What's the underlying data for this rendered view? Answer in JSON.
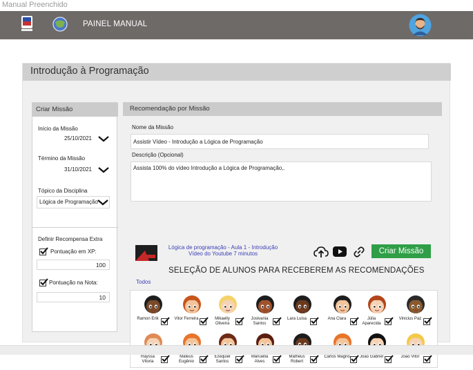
{
  "document_title": "Manual Preenchido",
  "topbar": {
    "title": "PAINEL MANUAL"
  },
  "course": {
    "title": "Introdução à Programação"
  },
  "create_mission": {
    "header": "Criar Missão",
    "start_label": "Início da Missão",
    "start_value": "25/10/2021",
    "end_label": "Término da Missão",
    "end_value": "31/10/2021",
    "topic_label": "Tópico da Disciplina",
    "topic_value": "Lógica de Programação"
  },
  "reward": {
    "header": "Definir Recompensa Extra",
    "xp_label": "Pontuação em XP:",
    "xp_value": "100",
    "xp_checked": true,
    "grade_label": "Pontuação na Nota:",
    "grade_value": "10",
    "grade_checked": true
  },
  "recommendation": {
    "header": "Recomendação por Missão",
    "name_label": "Nome da Missão",
    "name_value": "Assistir Vídeo - Introdução a Lógica de Programação",
    "desc_label": "Descrição (Opcional)",
    "desc_value": "Assista 100% do vídeo Introdução a Lógica de Programação,.",
    "video_title": "Lógica de programação - Aula 1 - Introdução",
    "video_subtitle": "Vídeo do Youtube 7 minutos",
    "create_button": "Criar Missão",
    "icons": [
      "cloud-upload-icon",
      "youtube-play-icon",
      "link-icon"
    ]
  },
  "selection": {
    "title": "SELEÇÃO DE ALUNOS PARA RECEBEREM AS RECOMENDAÇÕES",
    "all_link": "Todos",
    "students": [
      {
        "name": "Ramon Erik",
        "hair": "#1d1d1d",
        "skin": "#7a4a2a",
        "checked": true
      },
      {
        "name": "Vitor Ferreira",
        "hair": "#c8541c",
        "skin": "#f3c49a",
        "checked": true
      },
      {
        "name": "Mikaelly Oliveira",
        "hair": "#f3d36a",
        "skin": "#f6d2b4",
        "checked": true
      },
      {
        "name": "Josivania Santos",
        "hair": "#1d1d1d",
        "skin": "#a0522d",
        "checked": true
      },
      {
        "name": "Lara Luisa",
        "hair": "#1d1d1d",
        "skin": "#6b3a1e",
        "checked": true
      },
      {
        "name": "Ana Clara",
        "hair": "#1d1d1d",
        "skin": "#f3c49a",
        "checked": true
      },
      {
        "name": "Júlia Aparecida",
        "hair": "#b2451a",
        "skin": "#f6d2b4",
        "checked": true
      },
      {
        "name": "Vinicius Paz",
        "hair": "#2a2a2a",
        "skin": "#8a5a2e",
        "checked": true
      },
      {
        "name": "Rayssa Vitoria",
        "hair": "#e08a55",
        "skin": "#f6d2b4",
        "checked": true
      },
      {
        "name": "Mateus Eugênio",
        "hair": "#e8742a",
        "skin": "#f3c49a",
        "checked": true
      },
      {
        "name": "Ezequiel Santos",
        "hair": "#6e2a14",
        "skin": "#f3c49a",
        "checked": true
      },
      {
        "name": "Manuella Alves",
        "hair": "#5a1e10",
        "skin": "#f3c49a",
        "checked": true
      },
      {
        "name": "Matheus Robert",
        "hair": "#1d1d1d",
        "skin": "#6b3a1e",
        "checked": true
      },
      {
        "name": "Carlos Magno",
        "hair": "#e8742a",
        "skin": "#f3c49a",
        "checked": true
      },
      {
        "name": "João Gabriel",
        "hair": "#111111",
        "skin": "#f6d2b4",
        "checked": true
      },
      {
        "name": "João Vitor",
        "hair": "#f3c94a",
        "skin": "#f6d2b4",
        "checked": true
      }
    ]
  }
}
